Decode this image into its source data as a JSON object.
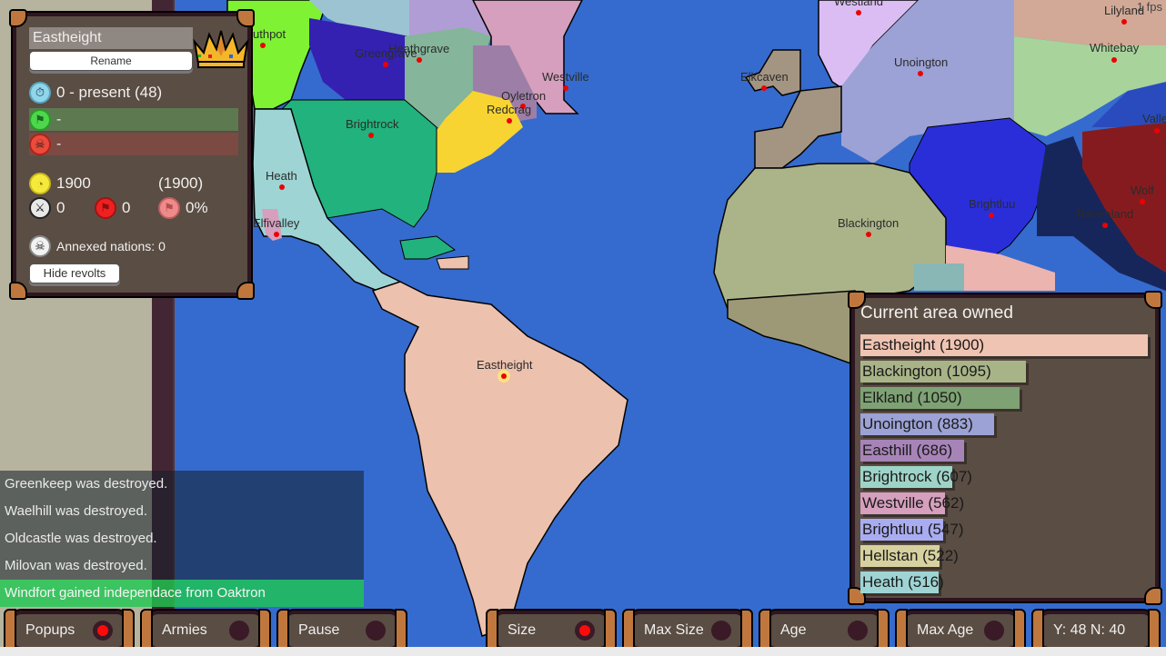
{
  "fps": "1 fps",
  "nation_panel": {
    "name": "Eastheight",
    "rename_label": "Rename",
    "lifespan": "0 - present (48)",
    "allies_text": "-",
    "enemies_text": "-",
    "area": "1900",
    "max_area": "(1900)",
    "battles": "0",
    "revolts": "0",
    "revolt_pct": "0%",
    "annexed": "Annexed nations: 0",
    "hide_revolts_label": "Hide revolts"
  },
  "event_log": [
    {
      "text": "Greenkeep was destroyed."
    },
    {
      "text": "Waelhill was destroyed."
    },
    {
      "text": "Oldcastle was destroyed."
    },
    {
      "text": "Milovan was destroyed."
    },
    {
      "text": "Windfort gained independace from Oaktron",
      "highlight": true
    }
  ],
  "chart_data": {
    "type": "bar",
    "title": "Current area owned",
    "orientation": "horizontal",
    "categories": [
      "Eastheight",
      "Blackington",
      "Elkland",
      "Unoington",
      "Easthill",
      "Brightrock",
      "Westville",
      "Brightluu",
      "Hellstan",
      "Heath"
    ],
    "values": [
      1900,
      1095,
      1050,
      883,
      686,
      607,
      562,
      547,
      522,
      516
    ],
    "colors": [
      "#f0c4b2",
      "#a8b487",
      "#7ea274",
      "#9ca2d5",
      "#a784b8",
      "#9ed4c7",
      "#d59fbd",
      "#a9acf0",
      "#d7d19f",
      "#9fd4d4"
    ],
    "xlim": [
      0,
      1900
    ]
  },
  "map_labels": [
    {
      "name": "Southpot",
      "text": "uthpot"
    },
    {
      "name": "Greengrave",
      "text": "Greengrave"
    },
    {
      "name": "Heathgrave",
      "text": "Heathgrave"
    },
    {
      "name": "Westville",
      "text": "Westville"
    },
    {
      "name": "Oyletron",
      "text": "Oyletron"
    },
    {
      "name": "Redcrag",
      "text": "Redcrag"
    },
    {
      "name": "Brightrock",
      "text": "Brightrock"
    },
    {
      "name": "Heath",
      "text": "Heath"
    },
    {
      "name": "Elfivalley",
      "text": "Elfivalley"
    },
    {
      "name": "Eastheight",
      "text": "Eastheight"
    },
    {
      "name": "Westland",
      "text": "Westland"
    },
    {
      "name": "Elkcaven",
      "text": "Elkcaven"
    },
    {
      "name": "Unoington",
      "text": "Unoington"
    },
    {
      "name": "Lilyland",
      "text": "Lilyland"
    },
    {
      "name": "Whitebay",
      "text": "Whitebay"
    },
    {
      "name": "Valle",
      "text": "Valle"
    },
    {
      "name": "Wolf",
      "text": "Wolf"
    },
    {
      "name": "Brightluu",
      "text": "Brightluu"
    },
    {
      "name": "Ravenland",
      "text": "Ravenland"
    },
    {
      "name": "Blackington",
      "text": "Blackington"
    }
  ],
  "toolbar": [
    {
      "label": "Popups",
      "on": true
    },
    {
      "label": "Armies",
      "on": false
    },
    {
      "label": "Pause",
      "on": false
    },
    {
      "label": "Size",
      "on": true
    },
    {
      "label": "Max Size",
      "on": false
    },
    {
      "label": "Age",
      "on": false
    },
    {
      "label": "Max Age",
      "on": false
    },
    {
      "label": "Y: 48 N: 40",
      "on": null
    }
  ]
}
